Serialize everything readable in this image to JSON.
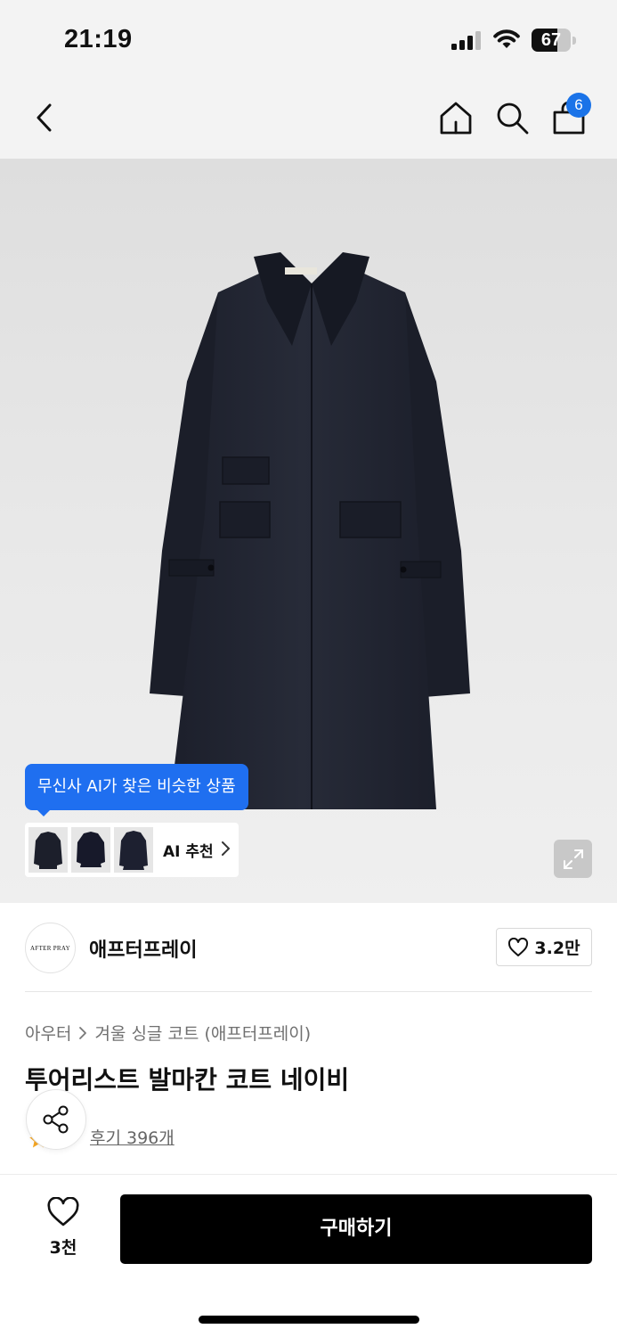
{
  "status_bar": {
    "time": "21:19",
    "battery": "67",
    "battery_level": 0.67,
    "icons": [
      "signal-icon",
      "wifi-icon",
      "battery-icon"
    ]
  },
  "nav": {
    "icons": [
      "back-icon",
      "home-icon",
      "search-icon",
      "cart-icon"
    ],
    "cart_badge": "6",
    "accent_color": "#1a73e8"
  },
  "hero": {
    "ai_tooltip": "무신사 AI가 찾은 비슷한 상품",
    "ai_label": "AI 추천",
    "tooltip_color": "#1f6ff0",
    "icons": [
      "chevron-right-icon",
      "expand-icon"
    ]
  },
  "brand": {
    "logo_text": "AFTER PRAY",
    "name": "애프터프레이",
    "like_count": "3.2만",
    "icons": [
      "heart-icon"
    ]
  },
  "product": {
    "breadcrumb": [
      "아우터",
      "겨울 싱글 코트 (애프터프레이)"
    ],
    "title": "투어리스트 발마칸 코트 네이비",
    "rating": "5",
    "review_link": "후기 396개",
    "icons": [
      "star-icon",
      "share-icon"
    ]
  },
  "bottom_bar": {
    "wish_count": "3천",
    "buy_label": "구매하기",
    "icons": [
      "heart-outline-icon"
    ]
  }
}
